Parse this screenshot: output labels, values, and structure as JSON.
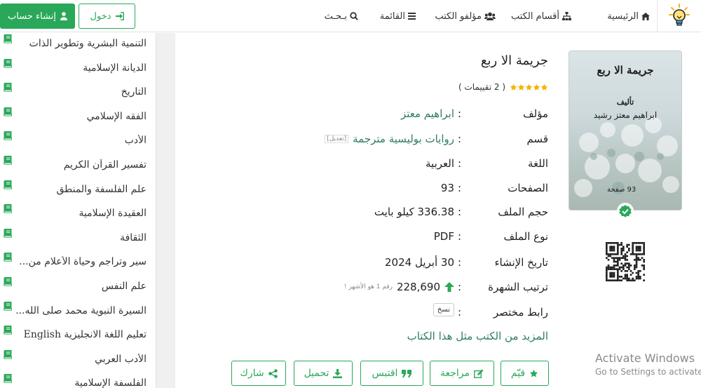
{
  "nav": {
    "home": "الرئيسية",
    "sections": "أقسام الكتب",
    "authors": "مؤلفو الكتب",
    "menu": "القائمة",
    "search": "بـحـث",
    "login": "دخول",
    "register": "إنشاء حساب"
  },
  "sidebar": {
    "categories": [
      {
        "label": "التنمية البشرية وتطوير الذات"
      },
      {
        "label": "الديانة الإسلامية"
      },
      {
        "label": "التاريخ"
      },
      {
        "label": "الفقه الإسلامي"
      },
      {
        "label": "الأدب"
      },
      {
        "label": "تفسير القرآن الكريم"
      },
      {
        "label": "علم الفلسفة والمنطق"
      },
      {
        "label": "العقيدة الإسلامية"
      },
      {
        "label": "الثقافة"
      },
      {
        "label": "سير وتراجم وحياة الأعلام من..."
      },
      {
        "label": "علم النفس"
      },
      {
        "label": "السيرة النبوية محمد صلى الله..."
      },
      {
        "label": "تعليم اللغة الانجليزية English"
      },
      {
        "label": "الأدب العربي"
      },
      {
        "label": "الفلسفة الإسلامية"
      }
    ]
  },
  "book": {
    "title": "جريمة الا ربع",
    "rating": 5,
    "rating_count": "( 2 تقييمات )",
    "cover": {
      "title": "جريمة الا ربع",
      "by": "تأليف",
      "author": "ابراهيم معتز رشيد",
      "pages": "93 صفحة"
    },
    "info": {
      "author_label": "مؤلف",
      "author_value": "ابراهيم معتز",
      "category_label": "قسم",
      "category_value": "روايات بوليسية مترجمة",
      "edit_label": "[تعديل]",
      "language_label": "اللغة",
      "language_value": "العربية",
      "pages_label": "الصفحات",
      "pages_value": "93",
      "size_label": "حجم الملف",
      "size_value": "336.38 كيلو بايت",
      "type_label": "نوع الملف",
      "type_value": "PDF",
      "created_label": "تاريخ الإنشاء",
      "created_value": "30 أبريل 2024",
      "rank_label": "ترتيب الشهرة",
      "rank_value": "228,690",
      "rank_note": "رقم 1 هو الأشهر !",
      "shortlink_label": "رابط مختصر",
      "copy_label": "نسخ"
    },
    "more_link": "المزيد من الكتب مثل هذا الكتاب"
  },
  "actions": {
    "rate": "قيّم",
    "review": "مراجعة",
    "quote": "اقتبس",
    "download": "تحميل",
    "share": "شارك"
  },
  "windows_watermark": {
    "title": "Activate Windows",
    "subtitle": "Go to Settings to activate"
  },
  "colors": {
    "accent": "#2aa85a",
    "link": "#2e7d5e",
    "star": "#f5b301"
  },
  "icons": {
    "logo": "lightbulb-icon",
    "home": "home-icon",
    "sections": "sitemap-icon",
    "authors": "users-icon",
    "menu": "bars-icon",
    "search": "search-icon",
    "login": "sign-in-icon",
    "register": "user-icon",
    "category": "book-icon",
    "verified": "check-badge-icon",
    "qr": "qr-code-icon",
    "rate": "star-icon",
    "review": "edit-icon",
    "quote": "quote-icon",
    "download": "download-icon",
    "share": "share-icon"
  }
}
